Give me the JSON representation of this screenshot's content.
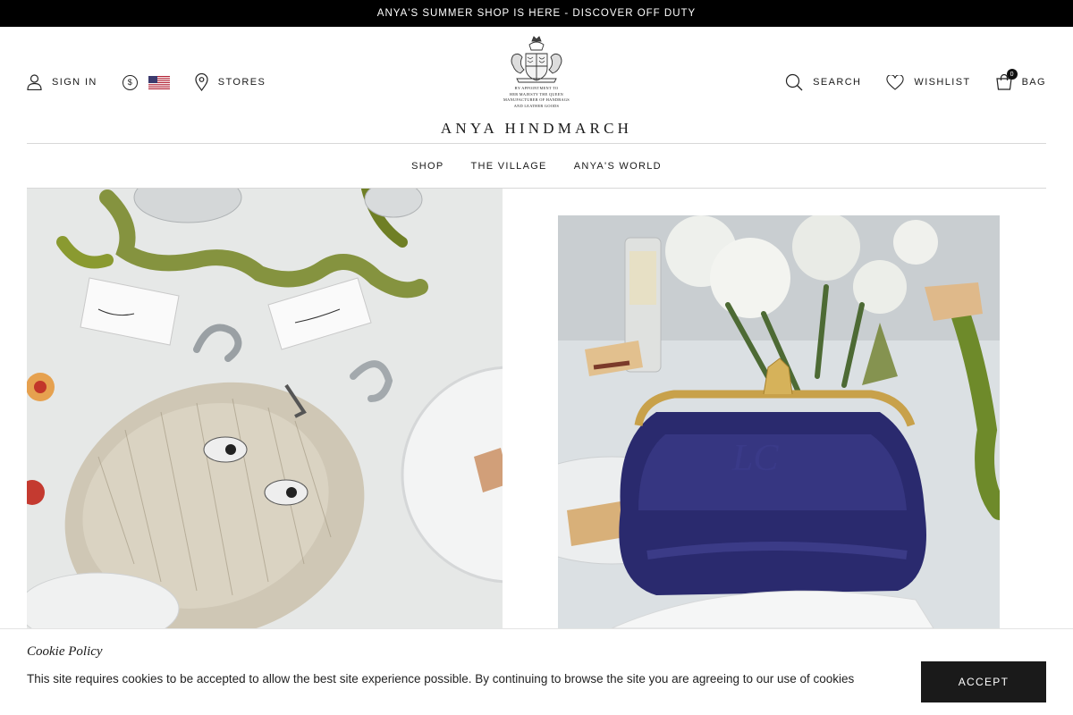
{
  "announcement": {
    "text": "ANYA'S SUMMER SHOP IS HERE - DISCOVER OFF DUTY"
  },
  "header": {
    "left": {
      "sign_in": "SIGN IN",
      "currency_symbol": "$",
      "currency_flag": "us-flag-icon",
      "stores": "STORES"
    },
    "right": {
      "search": "SEARCH",
      "wishlist": "WISHLIST",
      "bag": "BAG",
      "bag_count": "0"
    },
    "crest_lines": [
      "BY APPOINTMENT TO",
      "HER MAJESTY THE QUEEN",
      "MANUFACTURER OF HANDBAGS",
      "AND LEATHER GOODS"
    ],
    "brand": "ANYA HINDMARCH"
  },
  "nav": {
    "items": [
      "SHOP",
      "THE VILLAGE",
      "ANYA'S WORLD"
    ]
  },
  "cookie": {
    "title": "Cookie Policy",
    "text": "This site requires cookies to be accepted to allow the best site experience possible. By continuing to browse the site you are agreeing to our use of cookies",
    "accept": "ACCEPT"
  },
  "icons": {
    "sign_in": "user-icon",
    "currency": "dollar-icon",
    "stores": "location-pin-icon",
    "search": "search-icon",
    "wishlist": "heart-icon",
    "bag": "shopping-bag-icon"
  },
  "colors": {
    "announcement_bg": "#000000",
    "accept_bg": "#1a1a1a",
    "clutch_navy": "#2a2a6e"
  }
}
